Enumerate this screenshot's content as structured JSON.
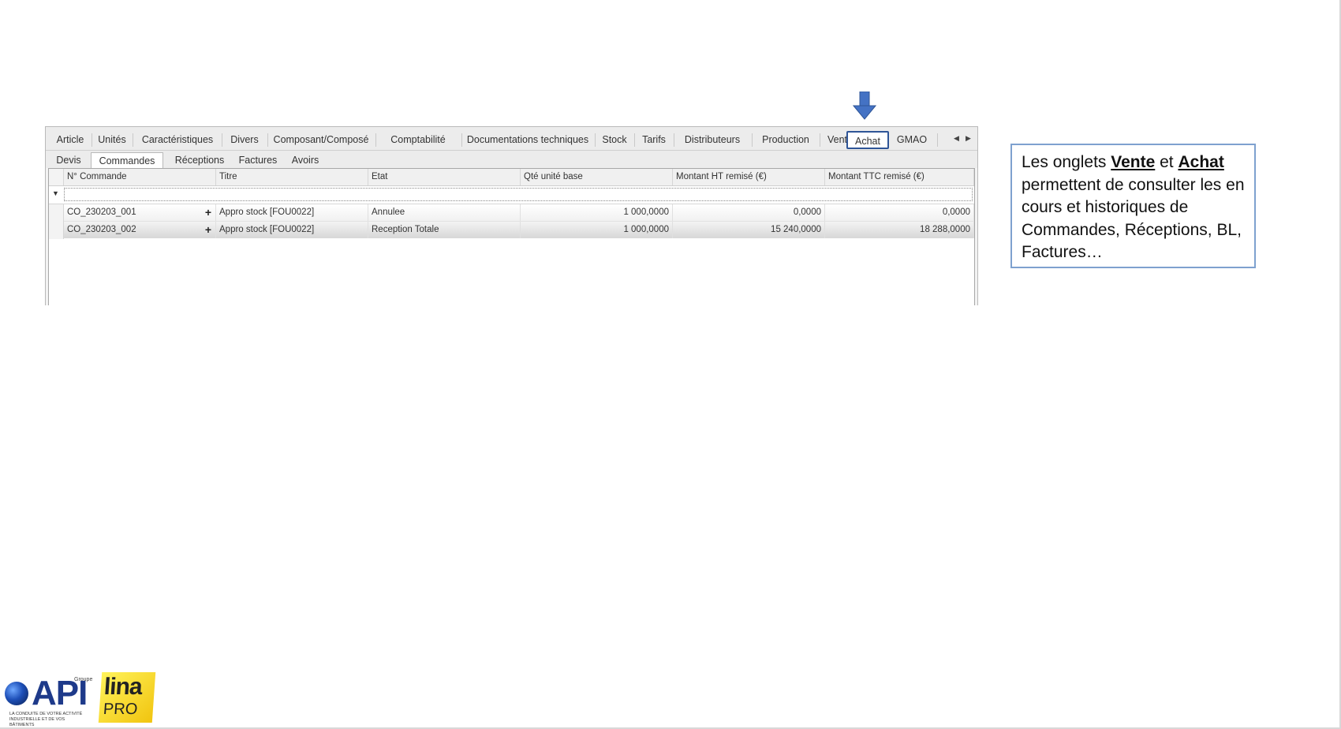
{
  "tabs_main": [
    "Article",
    "Unités",
    "Caractéristiques",
    "Divers",
    "Composant/Composé",
    "Comptabilité",
    "Documentations techniques",
    "Stock",
    "Tarifs",
    "Distributeurs",
    "Production",
    "Vente",
    "Achat",
    "GMAO"
  ],
  "active_main_tab": "Achat",
  "tabs_sub": [
    "Devis",
    "Commandes",
    "Réceptions",
    "Factures",
    "Avoirs"
  ],
  "active_sub_tab": "Commandes",
  "grid": {
    "columns": [
      "N° Commande",
      "Titre",
      "Etat",
      "Qté unité base",
      "Montant HT remisé (€)",
      "Montant TTC remisé (€)"
    ],
    "rows": [
      [
        "CO_230203_001",
        "Appro stock [FOU0022]",
        "Annulee",
        "1 000,0000",
        "0,0000",
        "0,0000"
      ],
      [
        "CO_230203_002",
        "Appro stock [FOU0022]",
        "Reception Totale",
        "1 000,0000",
        "15 240,0000",
        "18 288,0000"
      ]
    ],
    "expand_symbol": "+",
    "filter_icon": "▼"
  },
  "callout": {
    "t1": "Les onglets ",
    "b1": "Vente",
    "t2": " et ",
    "b2": "Achat",
    "t3": " permettent de consulter les en cours et historiques de Commandes, Réceptions, BL, Factures…"
  },
  "logos": {
    "api": "API",
    "api_groupe": "Groupe",
    "api_tagline": "LA CONDUITE DE VOTRE ACTIVITÉ INDUSTRIELLE ET DE VOS BÂTIMENTS",
    "lina": "lina",
    "pro": "PRO"
  },
  "colors": {
    "arrow": "#4472c4",
    "active_tab_border": "#2f5597",
    "callout_border": "#7ea1cf"
  }
}
